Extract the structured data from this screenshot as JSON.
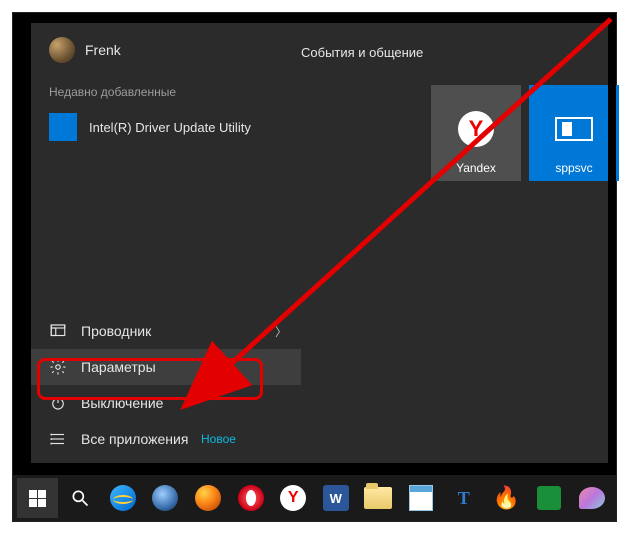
{
  "user": {
    "name": "Frenk"
  },
  "group_heading": "События и общение",
  "recently_added": {
    "label": "Недавно добавленные",
    "app": "Intel(R) Driver Update Utility"
  },
  "tiles": [
    {
      "name": "Yandex",
      "kind": "yandex"
    },
    {
      "name": "sppsvc",
      "kind": "sppsvc"
    }
  ],
  "nav": {
    "explorer": "Проводник",
    "settings": "Параметры",
    "power": "Выключение",
    "all_apps": "Все приложения",
    "new_label": "Новое"
  },
  "taskbar": {
    "items": [
      "start",
      "search",
      "ie",
      "srwiron",
      "firefox",
      "opera",
      "yandex",
      "word",
      "folder",
      "notepad",
      "tt",
      "flame",
      "green",
      "palette"
    ]
  }
}
